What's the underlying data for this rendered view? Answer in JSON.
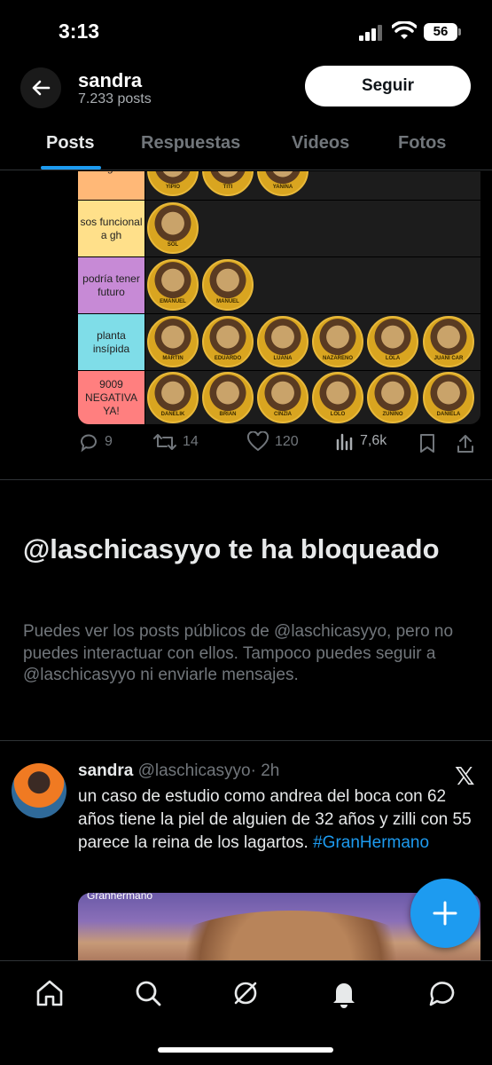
{
  "status_bar": {
    "time": "3:13",
    "battery": "56"
  },
  "header": {
    "name": "sandra",
    "posts_count": "7.233 posts",
    "follow_label": "Seguir"
  },
  "tabs": [
    {
      "label": "Posts",
      "active": true
    },
    {
      "label": "Respuestas",
      "active": false
    },
    {
      "label": "Videos",
      "active": false
    },
    {
      "label": "Fotos",
      "active": false
    }
  ],
  "tier_list": {
    "rows": [
      {
        "label": "me gusta",
        "color": "#ffb877",
        "faces": [
          "YIPIO",
          "TITI",
          "YANINA"
        ]
      },
      {
        "label": "sos funcional a gh",
        "color": "#ffe08a",
        "faces": [
          "SOL"
        ]
      },
      {
        "label": "podría tener futuro",
        "color": "#c78ad6",
        "faces": [
          "EMANUEL",
          "MANUEL"
        ]
      },
      {
        "label": "planta insípida",
        "color": "#7fdde8",
        "faces": [
          "MARTIN",
          "EDUARDO",
          "LUANA",
          "NAZARENO",
          "LOLA",
          "JUANI CAR"
        ]
      },
      {
        "label": "9009 NEGATIVA YA!",
        "color": "#ff7f7f",
        "faces": [
          "DANELIK",
          "BRIAN",
          "CINZIA",
          "LOLO",
          "ZUNINO",
          "DANIELA"
        ]
      }
    ]
  },
  "tweet_actions": {
    "replies": "9",
    "reposts": "14",
    "likes": "120",
    "views": "7,6k"
  },
  "blocked": {
    "title": "@laschicasyyo te ha bloqueado",
    "text": "Puedes ver los posts públicos de @laschicasyyo, pero no puedes interactuar con ellos. Tampoco puedes seguir a @laschicasyyo ni enviarle mensajes."
  },
  "tweet": {
    "name": "sandra",
    "handle": "@laschicasyyo",
    "time": "· 2h",
    "text": "un caso de estudio como andrea del boca con 62 años tiene la piel de alguien de 32 años y zilli con 55 parece la reina de los lagartos.",
    "hashtag": "#GranHermano",
    "media_watermark": "Granhermano"
  },
  "icons": {
    "back": "arrow-left-icon",
    "fab": "plus-icon",
    "nav": [
      "home-icon",
      "search-icon",
      "grok-icon",
      "notifications-icon",
      "messages-icon"
    ]
  },
  "colors": {
    "accent": "#1d9bf0",
    "background": "#000000",
    "muted": "#71767b"
  }
}
